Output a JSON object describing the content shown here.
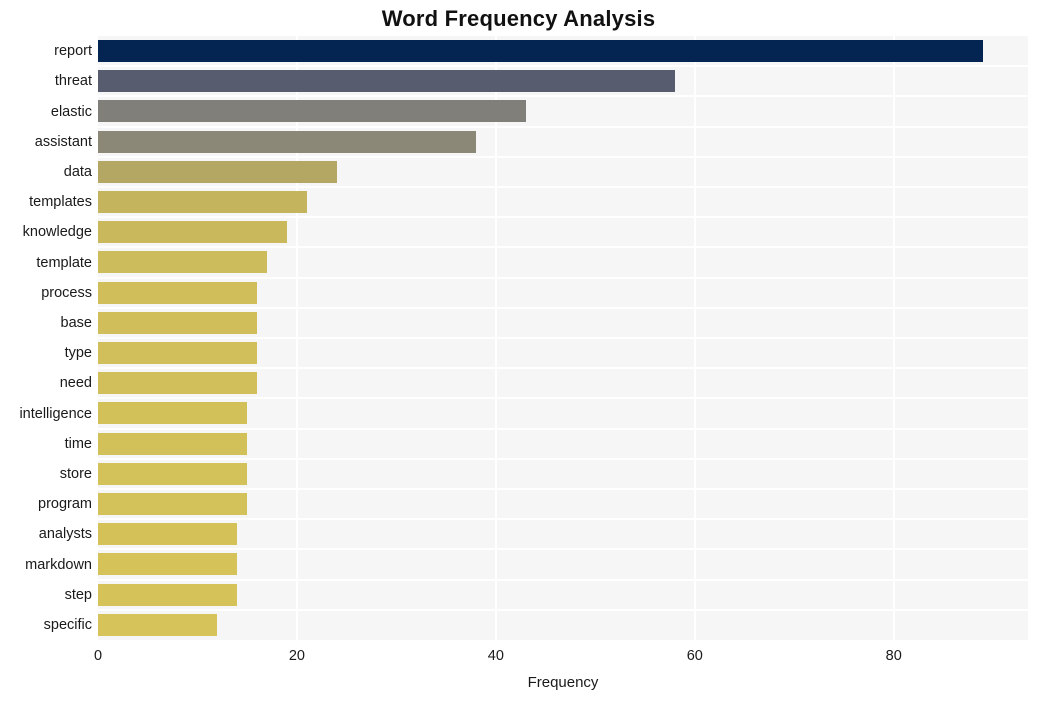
{
  "chart_data": {
    "type": "bar",
    "orientation": "horizontal",
    "title": "Word Frequency Analysis",
    "xlabel": "Frequency",
    "ylabel": "",
    "xlim": [
      0,
      93.5
    ],
    "xticks": [
      0,
      20,
      40,
      60,
      80
    ],
    "xtick_labels": [
      "0",
      "20",
      "40",
      "60",
      "80"
    ],
    "grid": true,
    "grid_color": "#ffffff",
    "plot_background": "#f6f6f6",
    "figure_background": "#ffffff",
    "legend": null,
    "categories": [
      "report",
      "threat",
      "elastic",
      "assistant",
      "data",
      "templates",
      "knowledge",
      "template",
      "process",
      "base",
      "type",
      "need",
      "intelligence",
      "time",
      "store",
      "program",
      "analysts",
      "markdown",
      "step",
      "specific"
    ],
    "values": [
      89,
      58,
      43,
      38,
      24,
      21,
      19,
      17,
      16,
      16,
      16,
      16,
      15,
      15,
      15,
      15,
      14,
      14,
      14,
      12
    ],
    "bar_colors": [
      "#042451",
      "#575d6e",
      "#807f7a",
      "#8b8877",
      "#b3a763",
      "#c4b45e",
      "#c9b95c",
      "#cdbc5b",
      "#cfbe5a",
      "#cfbe5a",
      "#d0bf5a",
      "#d0bf5a",
      "#d2c159",
      "#d2c159",
      "#d3c159",
      "#d3c159",
      "#d4c259",
      "#d5c259",
      "#d5c359",
      "#d6c359"
    ]
  }
}
